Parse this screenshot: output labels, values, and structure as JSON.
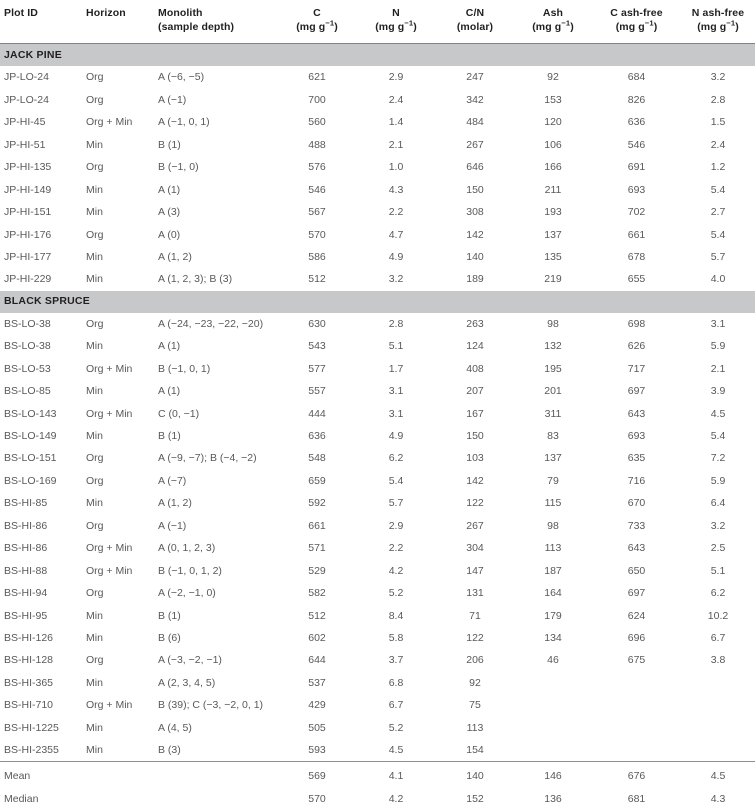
{
  "table": {
    "columns": [
      {
        "key": "plot_id",
        "label": "Plot ID",
        "unit": "",
        "align": "left"
      },
      {
        "key": "horizon",
        "label": "Horizon",
        "unit": "",
        "align": "left"
      },
      {
        "key": "monolith",
        "label": "Monolith",
        "unit": "(sample depth)",
        "align": "left"
      },
      {
        "key": "c",
        "label": "C",
        "unit": "(mg g−1)",
        "align": "center"
      },
      {
        "key": "n",
        "label": "N",
        "unit": "(mg g−1)",
        "align": "center"
      },
      {
        "key": "cn",
        "label": "C/N",
        "unit": "(molar)",
        "align": "center"
      },
      {
        "key": "ash",
        "label": "Ash",
        "unit": "(mg g−1)",
        "align": "center"
      },
      {
        "key": "c_ashfree",
        "label": "C ash-free",
        "unit": "(mg g−1)",
        "align": "center"
      },
      {
        "key": "n_ashfree",
        "label": "N ash-free",
        "unit": "(mg g−1)",
        "align": "center"
      }
    ],
    "unit_base": "(mg g",
    "unit_sup": "−1",
    "unit_close": ")",
    "molar_unit": "(molar)",
    "depth_unit": "(sample depth)",
    "sections": [
      {
        "title": "JACK PINE",
        "rows": [
          {
            "plot_id": "JP-LO-24",
            "horizon": "Org",
            "monolith": "A (−6, −5)",
            "c": "621",
            "n": "2.9",
            "cn": "247",
            "ash": "92",
            "c_ashfree": "684",
            "n_ashfree": "3.2"
          },
          {
            "plot_id": "JP-LO-24",
            "horizon": "Org",
            "monolith": "A (−1)",
            "c": "700",
            "n": "2.4",
            "cn": "342",
            "ash": "153",
            "c_ashfree": "826",
            "n_ashfree": "2.8"
          },
          {
            "plot_id": "JP-HI-45",
            "horizon": "Org + Min",
            "monolith": "A (−1, 0, 1)",
            "c": "560",
            "n": "1.4",
            "cn": "484",
            "ash": "120",
            "c_ashfree": "636",
            "n_ashfree": "1.5"
          },
          {
            "plot_id": "JP-HI-51",
            "horizon": "Min",
            "monolith": "B (1)",
            "c": "488",
            "n": "2.1",
            "cn": "267",
            "ash": "106",
            "c_ashfree": "546",
            "n_ashfree": "2.4"
          },
          {
            "plot_id": "JP-HI-135",
            "horizon": "Org",
            "monolith": "B (−1, 0)",
            "c": "576",
            "n": "1.0",
            "cn": "646",
            "ash": "166",
            "c_ashfree": "691",
            "n_ashfree": "1.2"
          },
          {
            "plot_id": "JP-HI-149",
            "horizon": "Min",
            "monolith": "A (1)",
            "c": "546",
            "n": "4.3",
            "cn": "150",
            "ash": "211",
            "c_ashfree": "693",
            "n_ashfree": "5.4"
          },
          {
            "plot_id": "JP-HI-151",
            "horizon": "Min",
            "monolith": "A (3)",
            "c": "567",
            "n": "2.2",
            "cn": "308",
            "ash": "193",
            "c_ashfree": "702",
            "n_ashfree": "2.7"
          },
          {
            "plot_id": "JP-HI-176",
            "horizon": "Org",
            "monolith": "A (0)",
            "c": "570",
            "n": "4.7",
            "cn": "142",
            "ash": "137",
            "c_ashfree": "661",
            "n_ashfree": "5.4"
          },
          {
            "plot_id": "JP-HI-177",
            "horizon": "Min",
            "monolith": "A (1, 2)",
            "c": "586",
            "n": "4.9",
            "cn": "140",
            "ash": "135",
            "c_ashfree": "678",
            "n_ashfree": "5.7"
          },
          {
            "plot_id": "JP-HI-229",
            "horizon": "Min",
            "monolith": "A (1, 2, 3); B (3)",
            "c": "512",
            "n": "3.2",
            "cn": "189",
            "ash": "219",
            "c_ashfree": "655",
            "n_ashfree": "4.0"
          }
        ]
      },
      {
        "title": "BLACK SPRUCE",
        "rows": [
          {
            "plot_id": "BS-LO-38",
            "horizon": "Org",
            "monolith": "A (−24, −23, −22, −20)",
            "c": "630",
            "n": "2.8",
            "cn": "263",
            "ash": "98",
            "c_ashfree": "698",
            "n_ashfree": "3.1"
          },
          {
            "plot_id": "BS-LO-38",
            "horizon": "Min",
            "monolith": "A (1)",
            "c": "543",
            "n": "5.1",
            "cn": "124",
            "ash": "132",
            "c_ashfree": "626",
            "n_ashfree": "5.9"
          },
          {
            "plot_id": "BS-LO-53",
            "horizon": "Org + Min",
            "monolith": "B (−1, 0, 1)",
            "c": "577",
            "n": "1.7",
            "cn": "408",
            "ash": "195",
            "c_ashfree": "717",
            "n_ashfree": "2.1"
          },
          {
            "plot_id": "BS-LO-85",
            "horizon": "Min",
            "monolith": "A (1)",
            "c": "557",
            "n": "3.1",
            "cn": "207",
            "ash": "201",
            "c_ashfree": "697",
            "n_ashfree": "3.9"
          },
          {
            "plot_id": "BS-LO-143",
            "horizon": "Org + Min",
            "monolith": "C (0, −1)",
            "c": "444",
            "n": "3.1",
            "cn": "167",
            "ash": "311",
            "c_ashfree": "643",
            "n_ashfree": "4.5"
          },
          {
            "plot_id": "BS-LO-149",
            "horizon": "Min",
            "monolith": "B (1)",
            "c": "636",
            "n": "4.9",
            "cn": "150",
            "ash": "83",
            "c_ashfree": "693",
            "n_ashfree": "5.4"
          },
          {
            "plot_id": "BS-LO-151",
            "horizon": "Org",
            "monolith": "A (−9, −7); B (−4, −2)",
            "c": "548",
            "n": "6.2",
            "cn": "103",
            "ash": "137",
            "c_ashfree": "635",
            "n_ashfree": "7.2"
          },
          {
            "plot_id": "BS-LO-169",
            "horizon": "Org",
            "monolith": "A (−7)",
            "c": "659",
            "n": "5.4",
            "cn": "142",
            "ash": "79",
            "c_ashfree": "716",
            "n_ashfree": "5.9"
          },
          {
            "plot_id": "BS-HI-85",
            "horizon": "Min",
            "monolith": "A (1, 2)",
            "c": "592",
            "n": "5.7",
            "cn": "122",
            "ash": "115",
            "c_ashfree": "670",
            "n_ashfree": "6.4"
          },
          {
            "plot_id": "BS-HI-86",
            "horizon": "Org",
            "monolith": "A (−1)",
            "c": "661",
            "n": "2.9",
            "cn": "267",
            "ash": "98",
            "c_ashfree": "733",
            "n_ashfree": "3.2"
          },
          {
            "plot_id": "BS-HI-86",
            "horizon": "Org + Min",
            "monolith": "A (0, 1, 2, 3)",
            "c": "571",
            "n": "2.2",
            "cn": "304",
            "ash": "113",
            "c_ashfree": "643",
            "n_ashfree": "2.5"
          },
          {
            "plot_id": "BS-HI-88",
            "horizon": "Org + Min",
            "monolith": "B (−1, 0, 1, 2)",
            "c": "529",
            "n": "4.2",
            "cn": "147",
            "ash": "187",
            "c_ashfree": "650",
            "n_ashfree": "5.1"
          },
          {
            "plot_id": "BS-HI-94",
            "horizon": "Org",
            "monolith": "A (−2, −1, 0)",
            "c": "582",
            "n": "5.2",
            "cn": "131",
            "ash": "164",
            "c_ashfree": "697",
            "n_ashfree": "6.2"
          },
          {
            "plot_id": "BS-HI-95",
            "horizon": "Min",
            "monolith": "B (1)",
            "c": "512",
            "n": "8.4",
            "cn": "71",
            "ash": "179",
            "c_ashfree": "624",
            "n_ashfree": "10.2"
          },
          {
            "plot_id": "BS-HI-126",
            "horizon": "Min",
            "monolith": "B (6)",
            "c": "602",
            "n": "5.8",
            "cn": "122",
            "ash": "134",
            "c_ashfree": "696",
            "n_ashfree": "6.7"
          },
          {
            "plot_id": "BS-HI-128",
            "horizon": "Org",
            "monolith": "A (−3, −2, −1)",
            "c": "644",
            "n": "3.7",
            "cn": "206",
            "ash": "46",
            "c_ashfree": "675",
            "n_ashfree": "3.8"
          },
          {
            "plot_id": "BS-HI-365",
            "horizon": "Min",
            "monolith": "A (2, 3, 4, 5)",
            "c": "537",
            "n": "6.8",
            "cn": "92",
            "ash": "",
            "c_ashfree": "",
            "n_ashfree": ""
          },
          {
            "plot_id": "BS-HI-710",
            "horizon": "Org + Min",
            "monolith": "B (39); C (−3, −2, 0, 1)",
            "c": "429",
            "n": "6.7",
            "cn": "75",
            "ash": "",
            "c_ashfree": "",
            "n_ashfree": ""
          },
          {
            "plot_id": "BS-HI-1225",
            "horizon": "Min",
            "monolith": "A (4, 5)",
            "c": "505",
            "n": "5.2",
            "cn": "113",
            "ash": "",
            "c_ashfree": "",
            "n_ashfree": ""
          },
          {
            "plot_id": "BS-HI-2355",
            "horizon": "Min",
            "monolith": "B (3)",
            "c": "593",
            "n": "4.5",
            "cn": "154",
            "ash": "",
            "c_ashfree": "",
            "n_ashfree": ""
          }
        ]
      }
    ],
    "summary": [
      {
        "plot_id": "Mean",
        "horizon": "",
        "monolith": "",
        "c": "569",
        "n": "4.1",
        "cn": "140",
        "ash": "146",
        "c_ashfree": "676",
        "n_ashfree": "4.5"
      },
      {
        "plot_id": "Median",
        "horizon": "",
        "monolith": "",
        "c": "570",
        "n": "4.2",
        "cn": "152",
        "ash": "136",
        "c_ashfree": "681",
        "n_ashfree": "4.3"
      }
    ]
  },
  "style": {
    "band_color": "#c6c8ca",
    "header_text_color": "#231f20",
    "body_text_color": "#58595b",
    "rule_color": "#7f8183"
  }
}
